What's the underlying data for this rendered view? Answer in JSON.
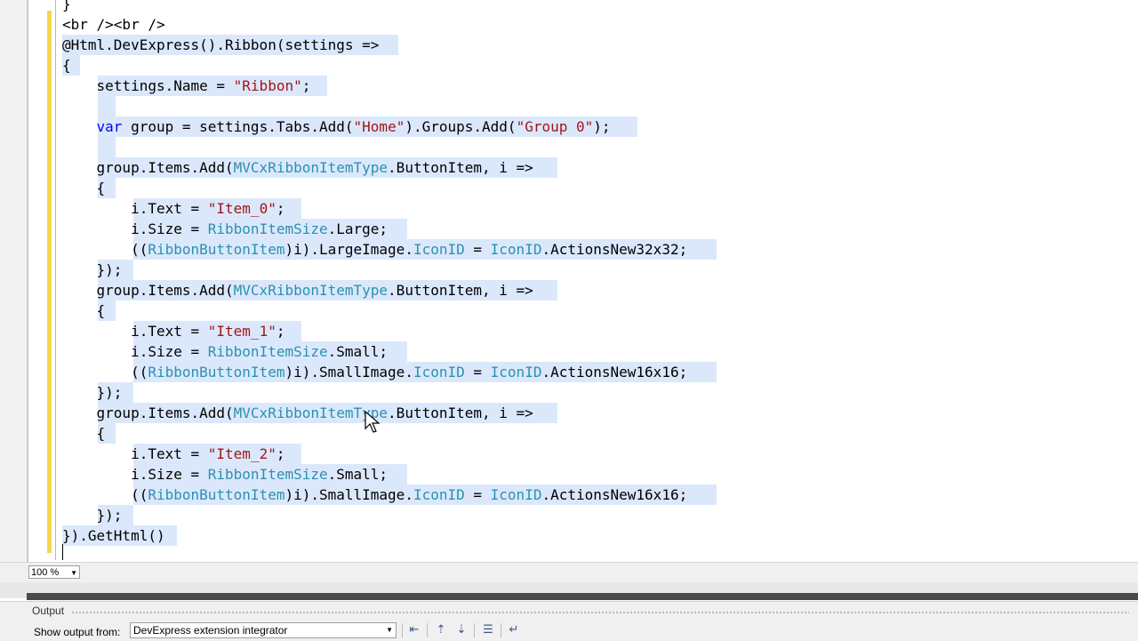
{
  "editor": {
    "lines": [
      "}",
      "<br /><br />",
      "@Html.DevExpress().Ribbon(settings =>",
      "{",
      "    settings.Name = \"Ribbon\";",
      "",
      "    var group = settings.Tabs.Add(\"Home\").Groups.Add(\"Group 0\");",
      "",
      "    group.Items.Add(MVCxRibbonItemType.ButtonItem, i =>",
      "    {",
      "        i.Text = \"Item_0\";",
      "        i.Size = RibbonItemSize.Large;",
      "        ((RibbonButtonItem)i).LargeImage.IconID = IconID.ActionsNew32x32;",
      "    });",
      "    group.Items.Add(MVCxRibbonItemType.ButtonItem, i =>",
      "    {",
      "        i.Text = \"Item_1\";",
      "        i.Size = RibbonItemSize.Small;",
      "        ((RibbonButtonItem)i).SmallImage.IconID = IconID.ActionsNew16x16;",
      "    });",
      "    group.Items.Add(MVCxRibbonItemType.ButtonItem, i =>",
      "    {",
      "        i.Text = \"Item_2\";",
      "        i.Size = RibbonItemSize.Small;",
      "        ((RibbonButtonItem)i).SmallImage.IconID = IconID.ActionsNew16x16;",
      "    });",
      "}).GetHtml()"
    ],
    "selection_color": "#dbe8fb",
    "change_bar_color": "#f5d54a"
  },
  "zoom": {
    "value": "100 %"
  },
  "output": {
    "title": "Output",
    "show_label": "Show output from:",
    "source": "DevExpress extension integrator",
    "toolbar_icons": [
      "find-message-icon",
      "goto-prev-icon",
      "goto-next-icon",
      "clear-all-icon",
      "word-wrap-icon"
    ]
  }
}
